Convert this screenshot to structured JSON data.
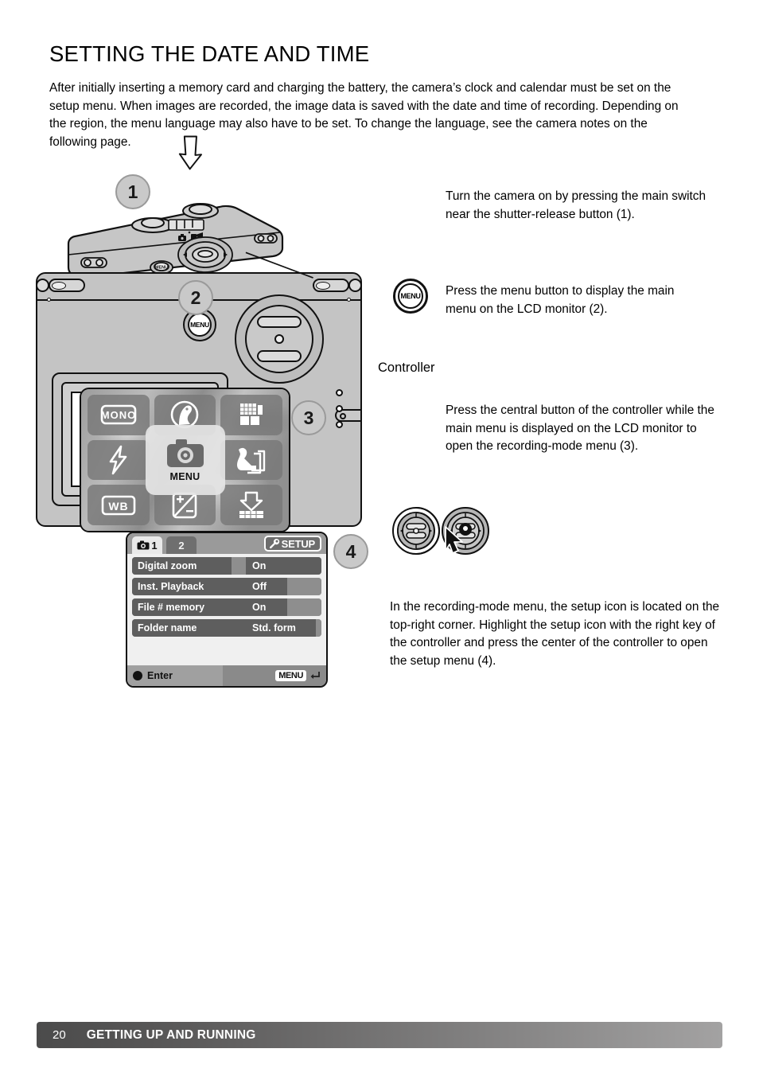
{
  "page": {
    "heading": "SETTING THE DATE AND TIME",
    "intro": "After initially inserting a memory card and charging the battery, the camera’s clock and calendar must be set on the setup menu. When images are recorded, the image data is saved with the date and time of recording. Depending on the region, the menu language may also have to be set. To change the language, see the camera notes on the following page."
  },
  "steps": {
    "one": "1",
    "two": "2",
    "three": "3",
    "four": "4"
  },
  "instructions": {
    "step1": "Turn the camera on by pressing the main switch near the shutter-release button (1).",
    "step2": "Press the menu button to display the main menu on the LCD monitor (2).",
    "step3": "Press the central button of the controller while the main menu is displayed on the LCD monitor to open the recording-mode menu (3).",
    "step4": "In the recording-mode menu, the setup icon is located on the top-right corner. Highlight the setup icon with the right key of the controller and press the center of the controller to open the setup menu (4)."
  },
  "callouts": {
    "controller": "Controller",
    "menu_button": "MENU"
  },
  "lcd_main_menu": {
    "center_label": "MENU",
    "center_icon": "camera-icon",
    "tiles": [
      {
        "name": "monochrome-icon",
        "label": "MONO"
      },
      {
        "name": "portrait-scene-icon",
        "label": ""
      },
      {
        "name": "image-quality-icon",
        "label": ""
      },
      {
        "name": "flash-mode-icon",
        "label": ""
      },
      {
        "name": "drive-mode-icon",
        "label": ""
      },
      {
        "name": "white-balance-icon",
        "label": "WB"
      },
      {
        "name": "exposure-compensation-icon",
        "label": ""
      },
      {
        "name": "image-size-icon",
        "label": ""
      }
    ]
  },
  "setup_menu": {
    "tabs": [
      {
        "label": "1",
        "icon": "camera-icon",
        "active": true
      },
      {
        "label": "2",
        "icon": "",
        "active": false
      }
    ],
    "setup_tab": {
      "label": "SETUP",
      "icon": "wrench-icon"
    },
    "rows": [
      {
        "name": "Digital zoom",
        "value": "On"
      },
      {
        "name": "Inst. Playback",
        "value": "Off"
      },
      {
        "name": "File # memory",
        "value": "On"
      },
      {
        "name": "Folder name",
        "value": "Std. form"
      }
    ],
    "footer": {
      "enter": "Enter",
      "menu": "MENU",
      "back_icon": "return-arrow-icon"
    }
  },
  "footer": {
    "page_number": "20",
    "section": "GETTING UP AND RUNNING"
  },
  "colors": {
    "body_gray": "#c4c4c4",
    "bubble_fill": "#c9c9c9",
    "bubble_border": "#9a9a9a",
    "row_dark": "#5e5e5e",
    "footer_dark": "#4b4b4b",
    "footer_light": "#a3a2a2"
  }
}
